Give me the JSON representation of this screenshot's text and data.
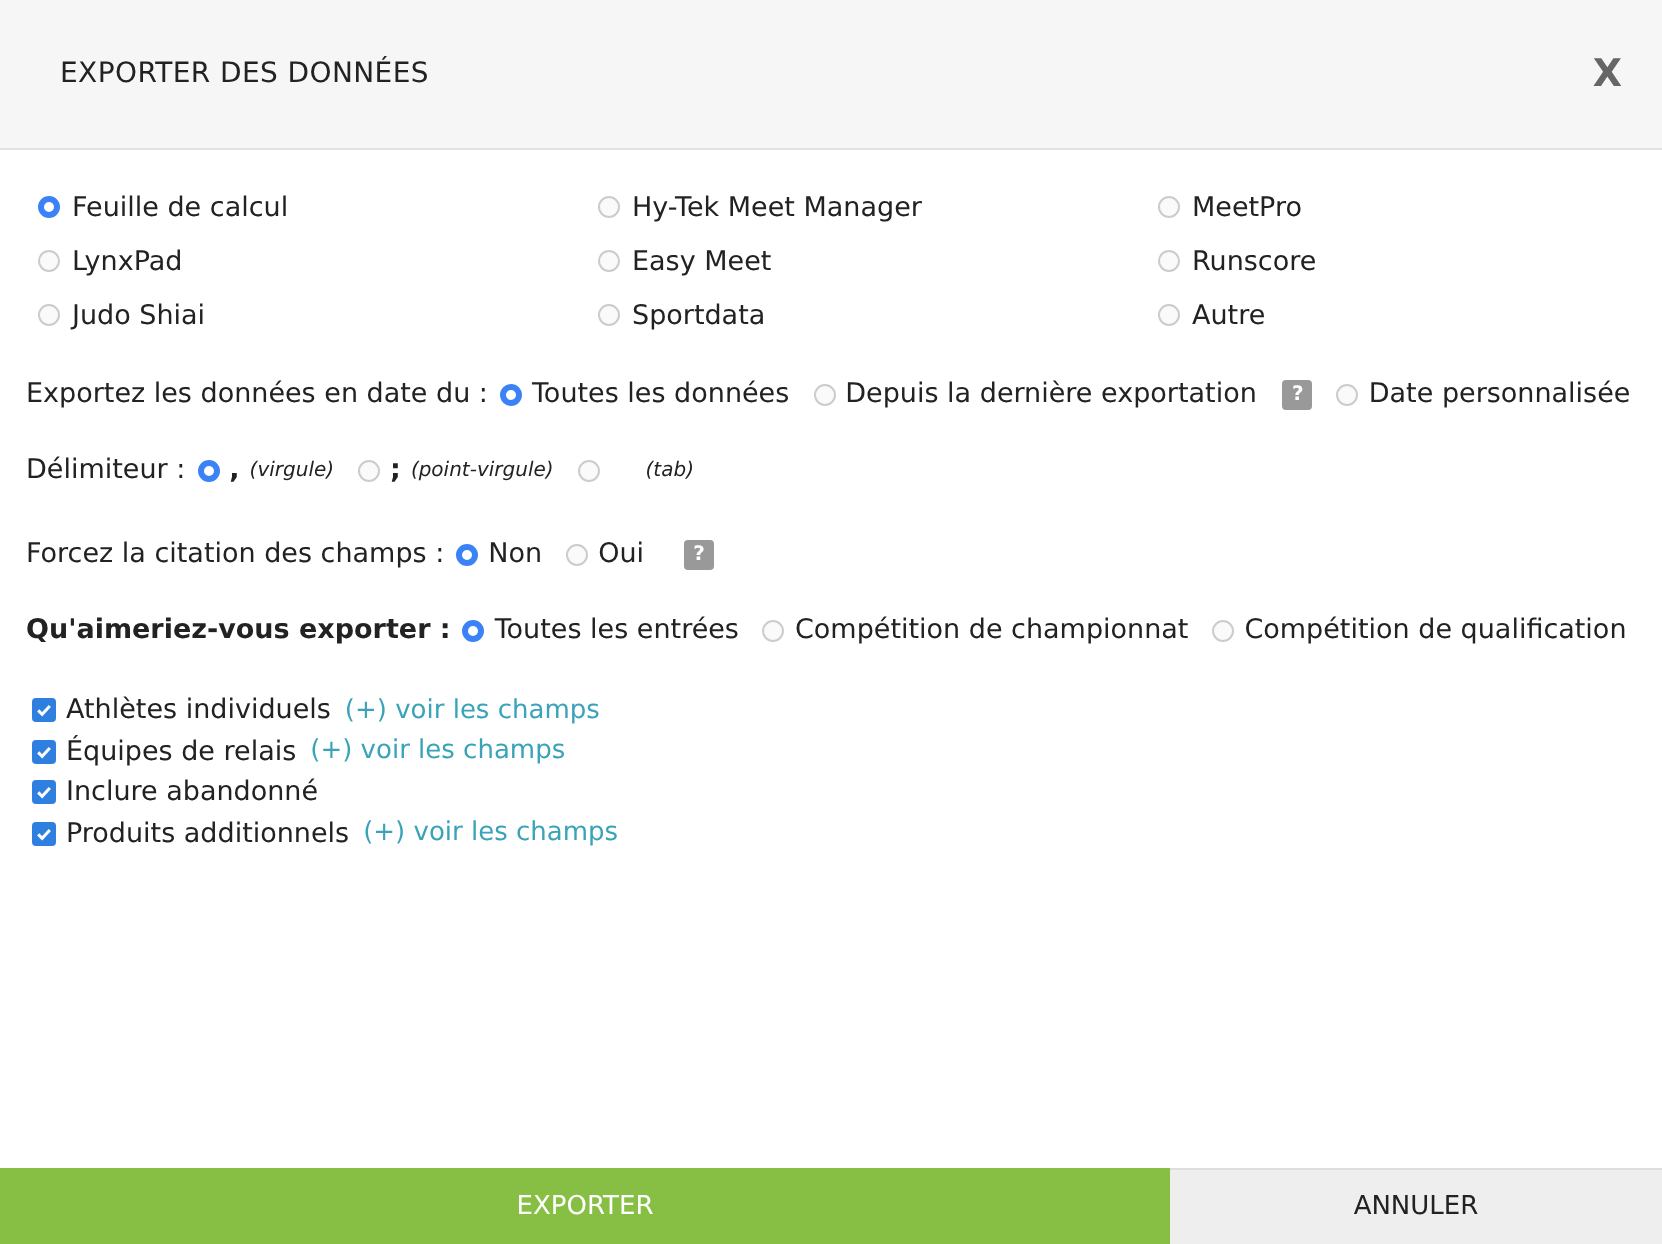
{
  "dialog": {
    "title": "EXPORTER DES DONNÉES",
    "close": "X"
  },
  "formats": [
    {
      "label": "Feuille de calcul",
      "selected": true
    },
    {
      "label": "Hy-Tek Meet Manager",
      "selected": false
    },
    {
      "label": "MeetPro",
      "selected": false
    },
    {
      "label": "LynxPad",
      "selected": false
    },
    {
      "label": "Easy Meet",
      "selected": false
    },
    {
      "label": "Runscore",
      "selected": false
    },
    {
      "label": "Judo Shiai",
      "selected": false
    },
    {
      "label": "Sportdata",
      "selected": false
    },
    {
      "label": "Autre",
      "selected": false
    }
  ],
  "option_rows": [
    {
      "label": "Exportez les données en date du :",
      "emphasis": false,
      "options": [
        {
          "label": "Toutes les données",
          "selected": true
        },
        {
          "label": "Depuis la dernière exportation",
          "help": "?",
          "selected": false
        },
        {
          "label": "Date personnalisée",
          "selected": false
        }
      ]
    },
    {
      "label": "Délimiteur :",
      "emphasis": false,
      "options": [
        {
          "symbol": ",",
          "note": "(virgule)",
          "selected": true
        },
        {
          "symbol": ";",
          "note": "(point-virgule)",
          "selected": false
        },
        {
          "note": "(tab)",
          "selected": false
        }
      ]
    },
    {
      "label": "Forcez la citation des champs :",
      "emphasis": false,
      "options": [
        {
          "label": "Non",
          "selected": true
        },
        {
          "label": "Oui",
          "selected": false
        }
      ],
      "help": "?"
    },
    {
      "label": "Qu'aimeriez-vous exporter :",
      "emphasis": true,
      "options": [
        {
          "label": "Toutes les entrées",
          "selected": true
        },
        {
          "label": "Compétition de championnat",
          "selected": false
        },
        {
          "label": "Compétition de qualification",
          "selected": false
        }
      ]
    }
  ],
  "checkboxes": [
    {
      "label": "Athlètes individuels",
      "link": "(+) voir les champs",
      "checked": true
    },
    {
      "label": "Équipes de relais",
      "link": "(+) voir les champs",
      "checked": true
    },
    {
      "label": "Inclure abandonné",
      "checked": true
    },
    {
      "label": "Produits additionnels",
      "link": "(+) voir les champs",
      "checked": true
    }
  ],
  "buttons": [
    {
      "label": "EXPORTER",
      "kind": "primary"
    },
    {
      "label": "ANNULER",
      "kind": "secondary"
    }
  ]
}
